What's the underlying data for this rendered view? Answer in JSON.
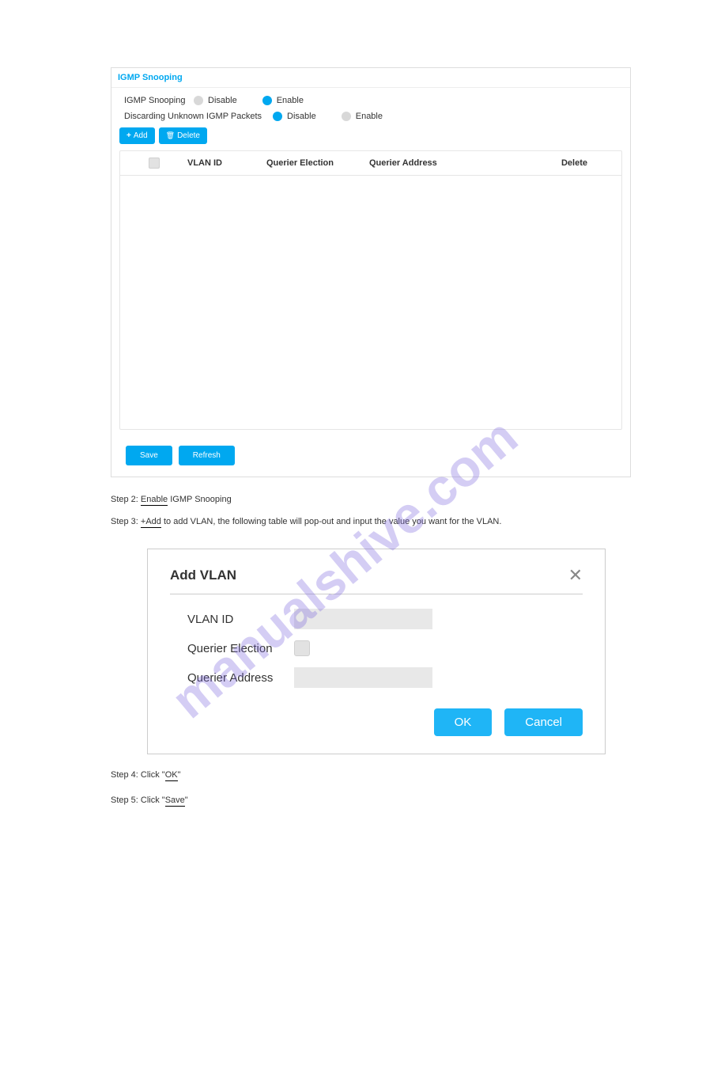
{
  "panel": {
    "title": "IGMP Snooping",
    "settings": {
      "igmp_snooping": {
        "label": "IGMP Snooping",
        "opt_disable": "Disable",
        "opt_enable": "Enable"
      },
      "discarding": {
        "label": "Discarding Unknown IGMP Packets",
        "opt_disable": "Disable",
        "opt_enable": "Enable"
      }
    },
    "buttons": {
      "add": "Add",
      "delete": "Delete"
    },
    "table": {
      "headers": {
        "vlan_id": "VLAN ID",
        "querier_election": "Querier Election",
        "querier_address": "Querier Address",
        "delete": "Delete"
      }
    },
    "footer": {
      "save": "Save",
      "refresh": "Refresh"
    }
  },
  "instructions": {
    "step2": "Step 2: ",
    "step2_action": "Enable",
    "step2_tail": " IGMP Snooping",
    "step3": "Step 3: ",
    "step3_action": "+Add",
    "step3_tail": " to add VLAN, the following table will pop-out and input the value you want for the VLAN.",
    "step4": "Step 4: Click \"",
    "step4_action": "OK",
    "step4_tail": "\"",
    "step5": "Step 5: Click \"",
    "step5_action": "Save",
    "step5_tail": "\""
  },
  "dialog": {
    "title": "Add VLAN",
    "fields": {
      "vlan_id": "VLAN ID",
      "querier_election": "Querier Election",
      "querier_address": "Querier Address"
    },
    "buttons": {
      "ok": "OK",
      "cancel": "Cancel"
    }
  },
  "watermark": "manualshive.com"
}
